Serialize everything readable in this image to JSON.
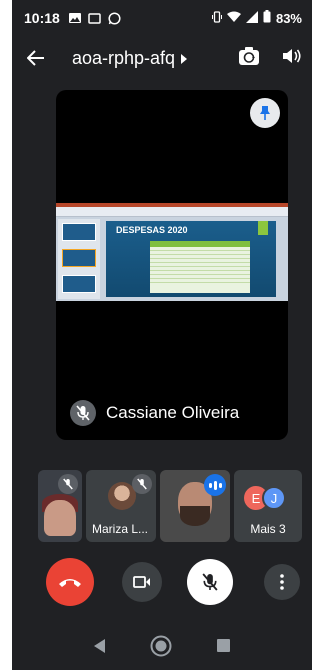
{
  "status_bar": {
    "time": "10:18",
    "battery": "83%",
    "icons": [
      "image-icon",
      "cast-icon",
      "whatsapp-icon",
      "vibrate-icon",
      "wifi-icon",
      "signal-icon",
      "battery-icon"
    ]
  },
  "top_bar": {
    "meeting_code": "aoa-rphp-afq",
    "icons": [
      "back-arrow-icon",
      "caret-right-icon",
      "switch-camera-icon",
      "speaker-icon"
    ]
  },
  "main_tile": {
    "participant_name": "Cassiane Oliveira",
    "muted": true,
    "pinned": true,
    "slide_title": "DESPESAS 2020"
  },
  "participants": [
    {
      "label": "",
      "muted": true
    },
    {
      "label": "Mariza L...",
      "muted": true
    },
    {
      "label": "",
      "speaking": true
    },
    {
      "label": "Mais 3",
      "avatars": [
        "E",
        "J"
      ]
    }
  ],
  "controls": [
    "end-call",
    "camera",
    "microphone",
    "more-options"
  ],
  "colors": {
    "background": "#202124",
    "end_call": "#ea4335",
    "tile": "#3c4043",
    "speaking": "#1a73e8",
    "avatar_e": "#ee675c",
    "avatar_j": "#5e97f6"
  }
}
